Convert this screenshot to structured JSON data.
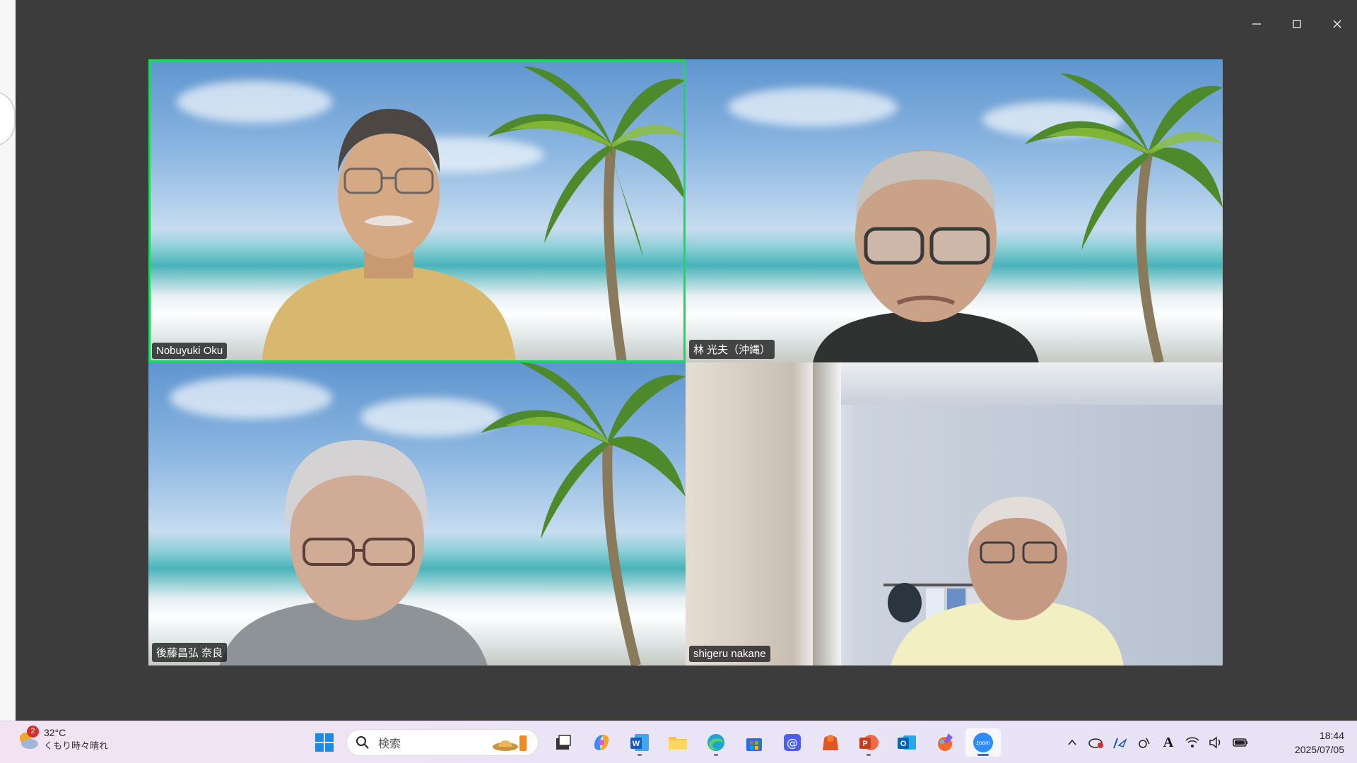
{
  "window": {
    "controls": [
      "minimize",
      "maximize",
      "close"
    ]
  },
  "participants": [
    {
      "name": "Nobuyuki Oku",
      "background": "beach",
      "active_speaker": true
    },
    {
      "name": "林 光夫（沖縄）",
      "background": "beach",
      "active_speaker": false
    },
    {
      "name": "後藤昌弘 奈良",
      "background": "beach",
      "active_speaker": false
    },
    {
      "name": "shigeru nakane",
      "background": "room",
      "active_speaker": false
    }
  ],
  "colors": {
    "active_speaker_border": "#1ed760",
    "window_bg": "#3c3c3c",
    "name_tag_bg": "#1e1e1e"
  },
  "taskbar": {
    "weather": {
      "badge": "2",
      "temperature": "32°C",
      "condition": "くもり時々晴れ"
    },
    "search": {
      "placeholder": "検索"
    },
    "pinned": [
      "start-icon",
      "task-view-icon",
      "copilot-icon",
      "word-icon",
      "file-explorer-icon",
      "edge-icon",
      "store-icon",
      "mail-icon",
      "office-icon",
      "powerpoint-icon",
      "outlook-icon",
      "paint-icon",
      "zoom-icon"
    ],
    "tray": [
      "chevron-up-icon",
      "onedrive-icon",
      "pen-icon",
      "sync-icon",
      "ime-icon",
      "wifi-icon",
      "volume-icon",
      "battery-icon"
    ],
    "ime_label": "A",
    "clock": {
      "time": "18:44",
      "date": "2025/07/05"
    }
  }
}
